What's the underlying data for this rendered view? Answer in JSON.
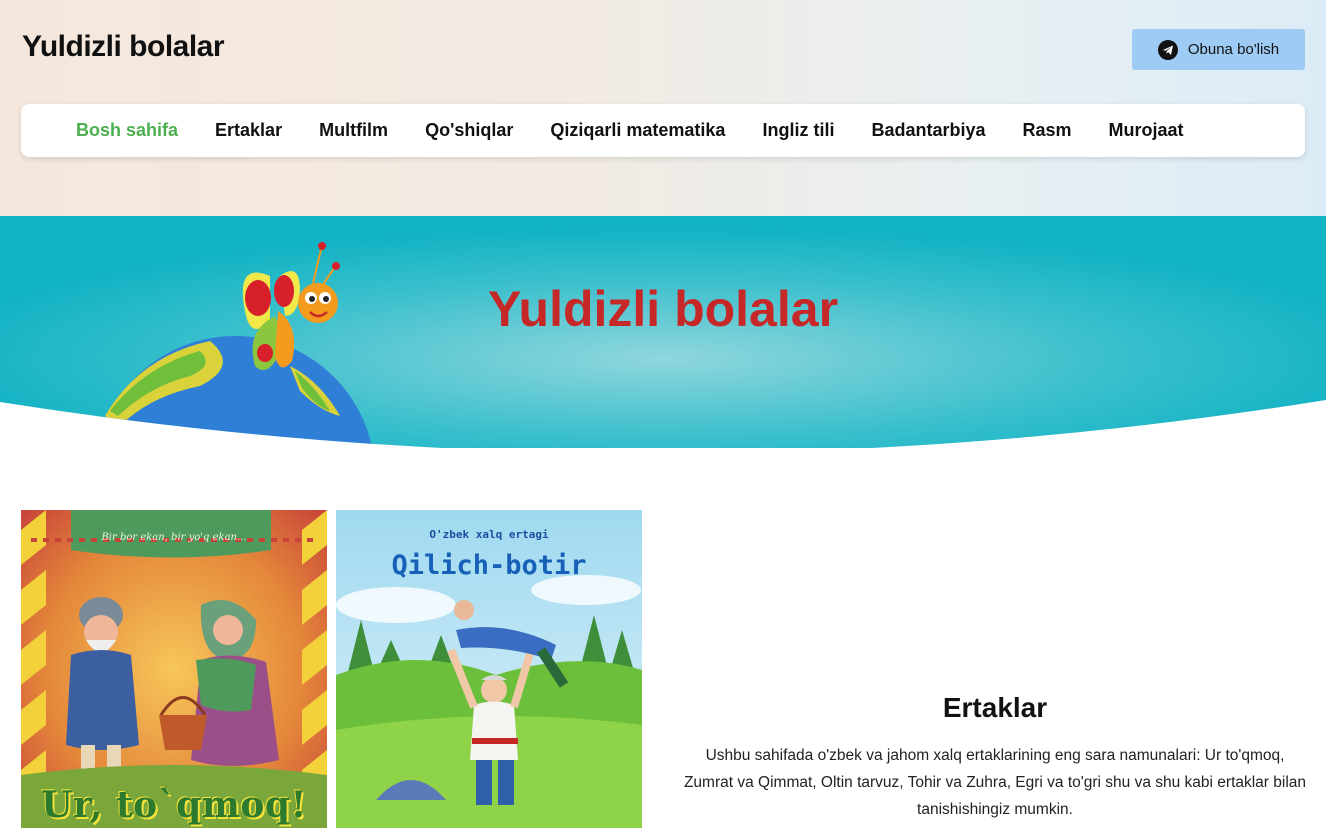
{
  "header": {
    "brand": "Yuldizli bolalar",
    "subscribe_label": "Obuna bo'lish",
    "subscribe_icon": "telegram-icon"
  },
  "nav": {
    "items": [
      {
        "label": "Bosh sahifa",
        "active": true
      },
      {
        "label": "Ertaklar"
      },
      {
        "label": "Multfilm"
      },
      {
        "label": "Qo'shiqlar"
      },
      {
        "label": "Qiziqarli matematika"
      },
      {
        "label": "Ingliz tili"
      },
      {
        "label": "Badantarbiya"
      },
      {
        "label": "Rasm"
      },
      {
        "label": "Murojaat"
      }
    ],
    "active_color": "#4caf50"
  },
  "hero": {
    "title": "Yuldizli bolalar",
    "title_color": "#c62828",
    "background": "#1db7c8"
  },
  "books": [
    {
      "series": "Bir bor ekan, bir yo'q ekan...",
      "title": "Ur, to`qmoq!"
    },
    {
      "subtitle": "O'zbek xalq ertagi",
      "title": "Qilich-botir"
    }
  ],
  "section": {
    "title": "Ertaklar",
    "text": "Ushbu sahifada o'zbek va jahom xalq ertaklarining eng sara namunalari: Ur to'qmoq, Zumrat va Qimmat, Oltin tarvuz, Tohir va Zuhra, Egri va to'gri shu va shu kabi ertaklar bilan tanishishingiz mumkin."
  }
}
